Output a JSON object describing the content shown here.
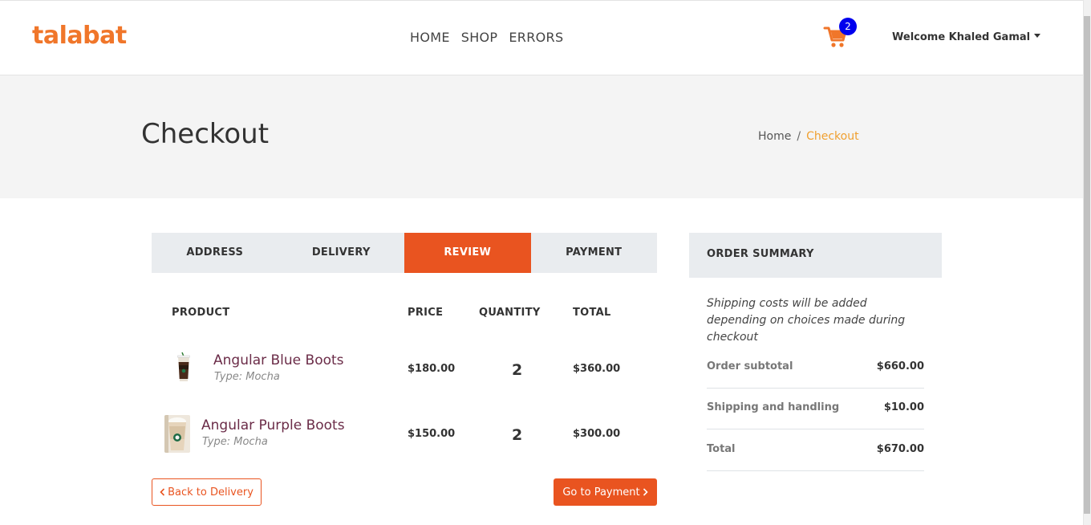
{
  "header": {
    "logo": "talabat",
    "nav": [
      "HOME",
      "SHOP",
      "ERRORS"
    ],
    "cart_count": "2",
    "welcome": "Welcome Khaled Gamal",
    "cart_icon": "shopping-cart-icon",
    "accent_color": "#f0762a",
    "badge_color": "#0000ee"
  },
  "hero": {
    "title": "Checkout",
    "breadcrumb": [
      "Home",
      "/",
      "Checkout"
    ]
  },
  "steps": {
    "items": [
      "ADDRESS",
      "DELIVERY",
      "REVIEW",
      "PAYMENT"
    ],
    "active": "REVIEW",
    "active_color": "#e95420"
  },
  "table": {
    "headers": {
      "product": "PRODUCT",
      "price": "PRICE",
      "quantity": "QUANTITY",
      "total": "TOTAL"
    },
    "rows": [
      {
        "name": "Angular Blue Boots",
        "type": "Type: Mocha",
        "price": "$180.00",
        "quantity": "2",
        "total": "$360.00",
        "image": "iced-coffee-cup-image"
      },
      {
        "name": "Angular Purple Boots",
        "type": "Type: Mocha",
        "price": "$150.00",
        "quantity": "2",
        "total": "$300.00",
        "image": "frappuccino-cup-image"
      }
    ]
  },
  "buttons": {
    "back": "Back to Delivery",
    "next": "Go to Payment",
    "back_icon": "chevron-left-icon",
    "next_icon": "chevron-right-icon"
  },
  "summary": {
    "title": "ORDER SUMMARY",
    "note": "Shipping costs will be added depending on choices made during checkout",
    "rows": [
      {
        "label": "Order subtotal",
        "value": "$660.00"
      },
      {
        "label": "Shipping and handling",
        "value": "$10.00"
      },
      {
        "label": "Total",
        "value": "$670.00"
      }
    ]
  }
}
